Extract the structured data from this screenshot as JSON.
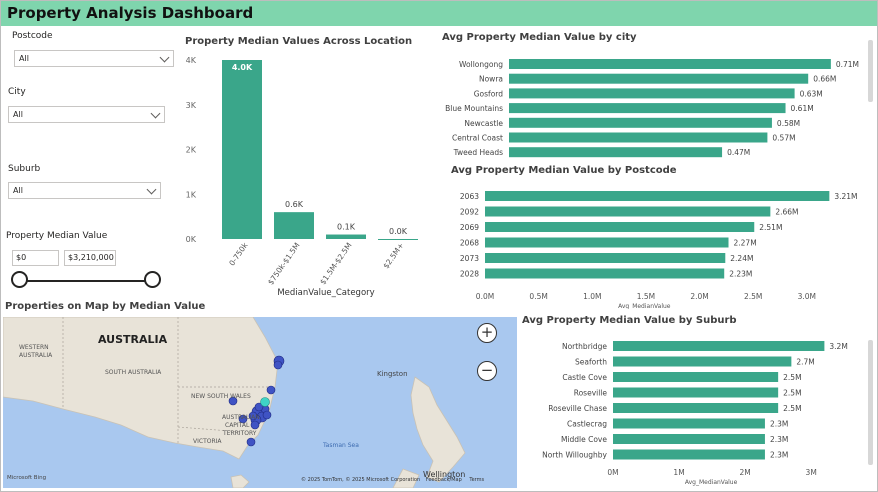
{
  "title": "Property Analysis Dashboard",
  "filters": {
    "postcode_label": "Postcode",
    "postcode_value": "All",
    "city_label": "City",
    "city_value": "All",
    "suburb_label": "Suburb",
    "suburb_value": "All",
    "median_label": "Property Median Value",
    "median_min": "$0",
    "median_max": "$3,210,000"
  },
  "colors": {
    "bar": "#3aa68a",
    "header": "#7fd5ad",
    "map_water": "#a9c8ef",
    "map_land": "#e8e3d8"
  },
  "chart_data": [
    {
      "type": "bar",
      "title": "Property Median Values Across Location",
      "categories": [
        "0-750k",
        "$750k-$1.5M",
        "$1.5M-$2.5M",
        "$2.5M+"
      ],
      "values": [
        4.0,
        0.6,
        0.1,
        0.0
      ],
      "value_labels": [
        "4.0K",
        "0.6K",
        "0.1K",
        "0.0K"
      ],
      "yticks": [
        "0K",
        "1K",
        "2K",
        "3K",
        "4K"
      ],
      "ylim": [
        0,
        4
      ],
      "xlabel": "MedianValue_Category",
      "ylabel": ""
    },
    {
      "type": "bar",
      "orientation": "horizontal",
      "title": "Avg Property Median Value by city",
      "categories": [
        "Wollongong",
        "Nowra",
        "Gosford",
        "Blue Mountains",
        "Newcastle",
        "Central Coast",
        "Tweed Heads"
      ],
      "values": [
        0.71,
        0.66,
        0.63,
        0.61,
        0.58,
        0.57,
        0.47
      ],
      "value_labels": [
        "0.71M",
        "0.66M",
        "0.63M",
        "0.61M",
        "0.58M",
        "0.57M",
        "0.47M"
      ],
      "xlim": [
        0,
        0.75
      ]
    },
    {
      "type": "bar",
      "orientation": "horizontal",
      "title": "Avg Property Median Value by Postcode",
      "categories": [
        "2063",
        "2092",
        "2069",
        "2068",
        "2073",
        "2028"
      ],
      "values": [
        3.21,
        2.66,
        2.51,
        2.27,
        2.24,
        2.23
      ],
      "value_labels": [
        "3.21M",
        "2.66M",
        "2.51M",
        "2.27M",
        "2.24M",
        "2.23M"
      ],
      "xticks": [
        "0.0M",
        "0.5M",
        "1.0M",
        "1.5M",
        "2.0M",
        "2.5M",
        "3.0M"
      ],
      "xlim": [
        0,
        3.3
      ],
      "xlabel": "Avg_MedianValue"
    },
    {
      "type": "bar",
      "orientation": "horizontal",
      "title": "Avg Property Median Value by Suburb",
      "categories": [
        "Northbridge",
        "Seaforth",
        "Castle Cove",
        "Roseville",
        "Roseville Chase",
        "Castlecrag",
        "Middle Cove",
        "North Willoughby"
      ],
      "values": [
        3.2,
        2.7,
        2.5,
        2.5,
        2.5,
        2.3,
        2.3,
        2.3
      ],
      "value_labels": [
        "3.2M",
        "2.7M",
        "2.5M",
        "2.5M",
        "2.5M",
        "2.3M",
        "2.3M",
        "2.3M"
      ],
      "xticks": [
        "0M",
        "1M",
        "2M",
        "3M"
      ],
      "xlim": [
        0,
        3.3
      ],
      "xlabel": "Avg_MedianValue"
    }
  ],
  "map": {
    "title": "Properties on Map by Median Value",
    "labels": {
      "australia": "AUSTRALIA",
      "western_australia": "WESTERN AUSTRALIA",
      "south_australia": "SOUTH AUSTRALIA",
      "nsw": "NEW SOUTH WALES",
      "act_1": "AUSTRALIAN",
      "act_2": "CAPITAL",
      "act_3": "TERRITORY",
      "victoria": "VICTORIA",
      "kingston": "Kingston",
      "tasman_sea": "Tasman Sea",
      "wellington": "Wellington"
    },
    "bing_logo": "Microsoft Bing",
    "copyright": "© 2025 TomTom, © 2025 Microsoft Corporation",
    "feedback": "Feedback/Map",
    "terms": "Terms",
    "zoom_in": "+",
    "zoom_out": "−"
  }
}
